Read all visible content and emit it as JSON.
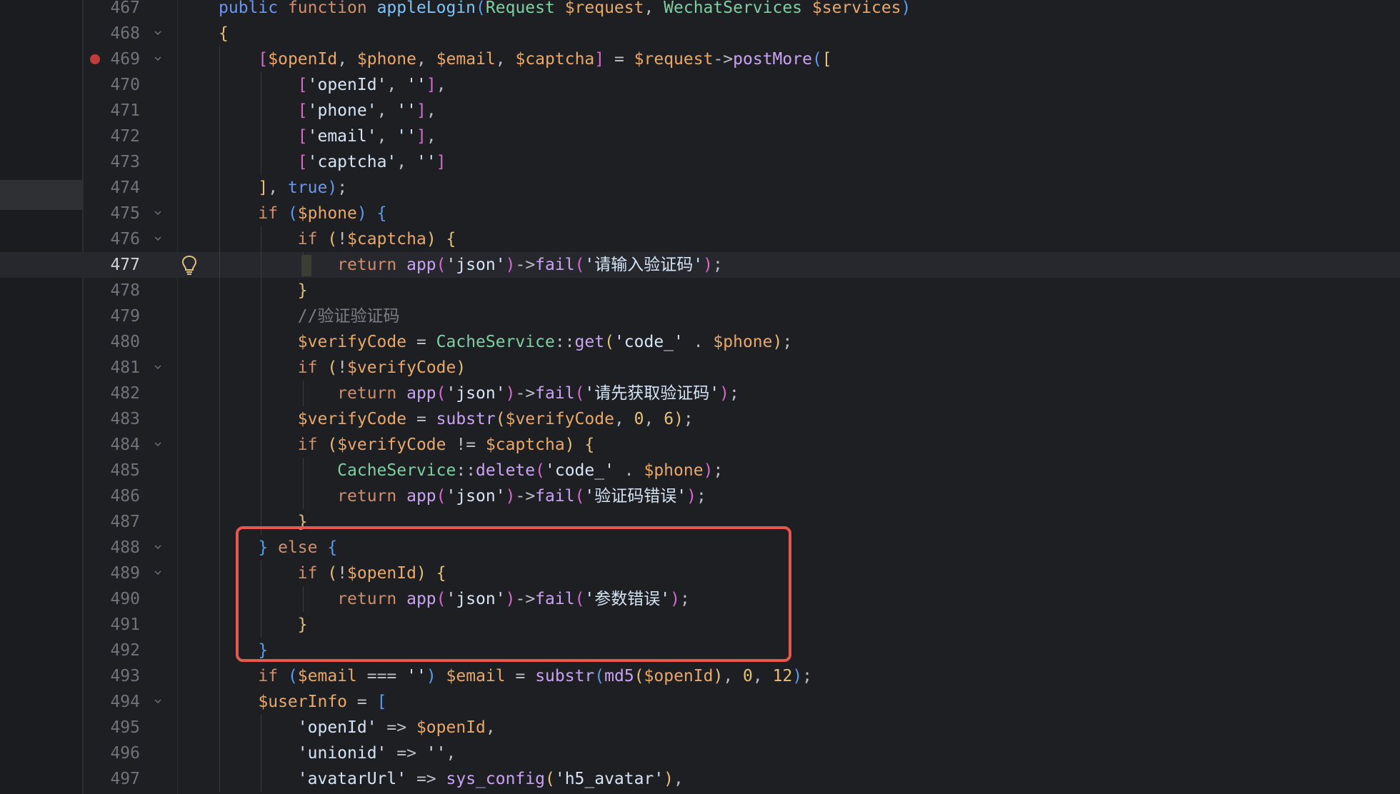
{
  "editor": {
    "lines": [
      {
        "n": "467",
        "tokens": [
          [
            "kwb",
            "public "
          ],
          [
            "kw",
            "function "
          ],
          [
            "fnd",
            "appleLogin"
          ],
          [
            "b3",
            "("
          ],
          [
            "cls",
            "Request "
          ],
          [
            "var",
            "$request"
          ],
          [
            "op",
            ", "
          ],
          [
            "cls",
            "WechatServices "
          ],
          [
            "var",
            "$services"
          ],
          [
            "b3",
            ")"
          ]
        ]
      },
      {
        "n": "468",
        "tokens": [
          [
            "b1",
            "{"
          ]
        ]
      },
      {
        "n": "469",
        "tokens": [
          [
            "op",
            "    "
          ],
          [
            "b2",
            "["
          ],
          [
            "var",
            "$openId"
          ],
          [
            "op",
            ", "
          ],
          [
            "var",
            "$phone"
          ],
          [
            "op",
            ", "
          ],
          [
            "var",
            "$email"
          ],
          [
            "op",
            ", "
          ],
          [
            "var",
            "$captcha"
          ],
          [
            "b2",
            "]"
          ],
          [
            "op",
            " = "
          ],
          [
            "var",
            "$request"
          ],
          [
            "op",
            "->"
          ],
          [
            "fn",
            "postMore"
          ],
          [
            "b3",
            "("
          ],
          [
            "b1",
            "["
          ]
        ]
      },
      {
        "n": "470",
        "tokens": [
          [
            "op",
            "        "
          ],
          [
            "b2",
            "["
          ],
          [
            "str",
            "'openId'"
          ],
          [
            "op",
            ", "
          ],
          [
            "str",
            "''"
          ],
          [
            "b2",
            "]"
          ],
          [
            "op",
            ","
          ]
        ]
      },
      {
        "n": "471",
        "tokens": [
          [
            "op",
            "        "
          ],
          [
            "b2",
            "["
          ],
          [
            "str",
            "'phone'"
          ],
          [
            "op",
            ", "
          ],
          [
            "str",
            "''"
          ],
          [
            "b2",
            "]"
          ],
          [
            "op",
            ","
          ]
        ]
      },
      {
        "n": "472",
        "tokens": [
          [
            "op",
            "        "
          ],
          [
            "b2",
            "["
          ],
          [
            "str",
            "'email'"
          ],
          [
            "op",
            ", "
          ],
          [
            "str",
            "''"
          ],
          [
            "b2",
            "]"
          ],
          [
            "op",
            ","
          ]
        ]
      },
      {
        "n": "473",
        "tokens": [
          [
            "op",
            "        "
          ],
          [
            "b2",
            "["
          ],
          [
            "str",
            "'captcha'"
          ],
          [
            "op",
            ", "
          ],
          [
            "str",
            "''"
          ],
          [
            "b2",
            "]"
          ]
        ]
      },
      {
        "n": "474",
        "tokens": [
          [
            "op",
            "    "
          ],
          [
            "b1",
            "]"
          ],
          [
            "op",
            ", "
          ],
          [
            "kwb",
            "true"
          ],
          [
            "b3",
            ")"
          ],
          [
            "op",
            ";"
          ]
        ]
      },
      {
        "n": "475",
        "tokens": [
          [
            "op",
            "    "
          ],
          [
            "kw",
            "if "
          ],
          [
            "b3",
            "("
          ],
          [
            "var",
            "$phone"
          ],
          [
            "b3",
            ") "
          ],
          [
            "b3",
            "{"
          ]
        ]
      },
      {
        "n": "476",
        "tokens": [
          [
            "op",
            "        "
          ],
          [
            "kw",
            "if "
          ],
          [
            "b1",
            "("
          ],
          [
            "op",
            "!"
          ],
          [
            "var",
            "$captcha"
          ],
          [
            "b1",
            ") "
          ],
          [
            "b1",
            "{"
          ]
        ]
      },
      {
        "n": "477",
        "tokens": [
          [
            "op",
            "            "
          ],
          [
            "kw",
            "return "
          ],
          [
            "fn",
            "app"
          ],
          [
            "b2",
            "("
          ],
          [
            "str",
            "'json'"
          ],
          [
            "b2",
            ")"
          ],
          [
            "op",
            "->"
          ],
          [
            "fn",
            "fail"
          ],
          [
            "b2",
            "("
          ],
          [
            "str",
            "'请输入验证码'"
          ],
          [
            "b2",
            ")"
          ],
          [
            "op",
            ";"
          ]
        ]
      },
      {
        "n": "478",
        "tokens": [
          [
            "op",
            "        "
          ],
          [
            "b1",
            "}"
          ]
        ]
      },
      {
        "n": "479",
        "tokens": [
          [
            "op",
            "        "
          ],
          [
            "cmt",
            "//验证验证码"
          ]
        ]
      },
      {
        "n": "480",
        "tokens": [
          [
            "op",
            "        "
          ],
          [
            "var",
            "$verifyCode"
          ],
          [
            "op",
            " = "
          ],
          [
            "cls",
            "CacheService"
          ],
          [
            "op",
            "::"
          ],
          [
            "fn",
            "get"
          ],
          [
            "b1",
            "("
          ],
          [
            "str",
            "'code_'"
          ],
          [
            "op",
            " . "
          ],
          [
            "var",
            "$phone"
          ],
          [
            "b1",
            ")"
          ],
          [
            "op",
            ";"
          ]
        ]
      },
      {
        "n": "481",
        "tokens": [
          [
            "op",
            "        "
          ],
          [
            "kw",
            "if "
          ],
          [
            "b1",
            "("
          ],
          [
            "op",
            "!"
          ],
          [
            "var",
            "$verifyCode"
          ],
          [
            "b1",
            ")"
          ]
        ]
      },
      {
        "n": "482",
        "tokens": [
          [
            "op",
            "            "
          ],
          [
            "kw",
            "return "
          ],
          [
            "fn",
            "app"
          ],
          [
            "b2",
            "("
          ],
          [
            "str",
            "'json'"
          ],
          [
            "b2",
            ")"
          ],
          [
            "op",
            "->"
          ],
          [
            "fn",
            "fail"
          ],
          [
            "b2",
            "("
          ],
          [
            "str",
            "'请先获取验证码'"
          ],
          [
            "b2",
            ")"
          ],
          [
            "op",
            ";"
          ]
        ]
      },
      {
        "n": "483",
        "tokens": [
          [
            "op",
            "        "
          ],
          [
            "var",
            "$verifyCode"
          ],
          [
            "op",
            " = "
          ],
          [
            "fn",
            "substr"
          ],
          [
            "b1",
            "("
          ],
          [
            "var",
            "$verifyCode"
          ],
          [
            "op",
            ", "
          ],
          [
            "num",
            "0"
          ],
          [
            "op",
            ", "
          ],
          [
            "num",
            "6"
          ],
          [
            "b1",
            ")"
          ],
          [
            "op",
            ";"
          ]
        ]
      },
      {
        "n": "484",
        "tokens": [
          [
            "op",
            "        "
          ],
          [
            "kw",
            "if "
          ],
          [
            "b1",
            "("
          ],
          [
            "var",
            "$verifyCode"
          ],
          [
            "op",
            " != "
          ],
          [
            "var",
            "$captcha"
          ],
          [
            "b1",
            ") "
          ],
          [
            "b1",
            "{"
          ]
        ]
      },
      {
        "n": "485",
        "tokens": [
          [
            "op",
            "            "
          ],
          [
            "cls",
            "CacheService"
          ],
          [
            "op",
            "::"
          ],
          [
            "fn",
            "delete"
          ],
          [
            "b2",
            "("
          ],
          [
            "str",
            "'code_'"
          ],
          [
            "op",
            " . "
          ],
          [
            "var",
            "$phone"
          ],
          [
            "b2",
            ")"
          ],
          [
            "op",
            ";"
          ]
        ]
      },
      {
        "n": "486",
        "tokens": [
          [
            "op",
            "            "
          ],
          [
            "kw",
            "return "
          ],
          [
            "fn",
            "app"
          ],
          [
            "b2",
            "("
          ],
          [
            "str",
            "'json'"
          ],
          [
            "b2",
            ")"
          ],
          [
            "op",
            "->"
          ],
          [
            "fn",
            "fail"
          ],
          [
            "b2",
            "("
          ],
          [
            "str",
            "'验证码错误'"
          ],
          [
            "b2",
            ")"
          ],
          [
            "op",
            ";"
          ]
        ]
      },
      {
        "n": "487",
        "tokens": [
          [
            "op",
            "        "
          ],
          [
            "b1",
            "}"
          ]
        ]
      },
      {
        "n": "488",
        "tokens": [
          [
            "op",
            "    "
          ],
          [
            "b3",
            "} "
          ],
          [
            "kw",
            "else "
          ],
          [
            "b3",
            "{"
          ]
        ]
      },
      {
        "n": "489",
        "tokens": [
          [
            "op",
            "        "
          ],
          [
            "kw",
            "if "
          ],
          [
            "b1",
            "("
          ],
          [
            "op",
            "!"
          ],
          [
            "var",
            "$openId"
          ],
          [
            "b1",
            ") "
          ],
          [
            "b1",
            "{"
          ]
        ]
      },
      {
        "n": "490",
        "tokens": [
          [
            "op",
            "            "
          ],
          [
            "kw",
            "return "
          ],
          [
            "fn",
            "app"
          ],
          [
            "b2",
            "("
          ],
          [
            "str",
            "'json'"
          ],
          [
            "b2",
            ")"
          ],
          [
            "op",
            "->"
          ],
          [
            "fn",
            "fail"
          ],
          [
            "b2",
            "("
          ],
          [
            "str",
            "'参数错误'"
          ],
          [
            "b2",
            ")"
          ],
          [
            "op",
            ";"
          ]
        ]
      },
      {
        "n": "491",
        "tokens": [
          [
            "op",
            "        "
          ],
          [
            "b1",
            "}"
          ]
        ]
      },
      {
        "n": "492",
        "tokens": [
          [
            "op",
            "    "
          ],
          [
            "b3",
            "}"
          ]
        ]
      },
      {
        "n": "493",
        "tokens": [
          [
            "op",
            "    "
          ],
          [
            "kw",
            "if "
          ],
          [
            "b3",
            "("
          ],
          [
            "var",
            "$email"
          ],
          [
            "op",
            " === "
          ],
          [
            "str",
            "''"
          ],
          [
            "b3",
            ") "
          ],
          [
            "var",
            "$email"
          ],
          [
            "op",
            " = "
          ],
          [
            "fn",
            "substr"
          ],
          [
            "b3",
            "("
          ],
          [
            "fn",
            "md5"
          ],
          [
            "b1",
            "("
          ],
          [
            "var",
            "$openId"
          ],
          [
            "b1",
            ")"
          ],
          [
            "op",
            ", "
          ],
          [
            "num",
            "0"
          ],
          [
            "op",
            ", "
          ],
          [
            "num",
            "12"
          ],
          [
            "b3",
            ")"
          ],
          [
            "op",
            ";"
          ]
        ]
      },
      {
        "n": "494",
        "tokens": [
          [
            "op",
            "    "
          ],
          [
            "var",
            "$userInfo"
          ],
          [
            "op",
            " = "
          ],
          [
            "b3",
            "["
          ]
        ]
      },
      {
        "n": "495",
        "tokens": [
          [
            "op",
            "        "
          ],
          [
            "str",
            "'openId'"
          ],
          [
            "op",
            " => "
          ],
          [
            "var",
            "$openId"
          ],
          [
            "op",
            ","
          ]
        ]
      },
      {
        "n": "496",
        "tokens": [
          [
            "op",
            "        "
          ],
          [
            "str",
            "'unionid'"
          ],
          [
            "op",
            " => "
          ],
          [
            "str",
            "''"
          ],
          [
            "op",
            ","
          ]
        ]
      },
      {
        "n": "497",
        "tokens": [
          [
            "op",
            "        "
          ],
          [
            "str",
            "'avatarUrl'"
          ],
          [
            "op",
            " => "
          ],
          [
            "fn",
            "sys_config"
          ],
          [
            "b1",
            "("
          ],
          [
            "str",
            "'h5_avatar'"
          ],
          [
            "b1",
            ")"
          ],
          [
            "op",
            ","
          ]
        ]
      }
    ],
    "current_line": "477",
    "breakpoint_line": "469",
    "bulb_line": "477",
    "fold_lines": [
      "468",
      "469",
      "475",
      "476",
      "481",
      "484",
      "488",
      "489",
      "494"
    ]
  }
}
